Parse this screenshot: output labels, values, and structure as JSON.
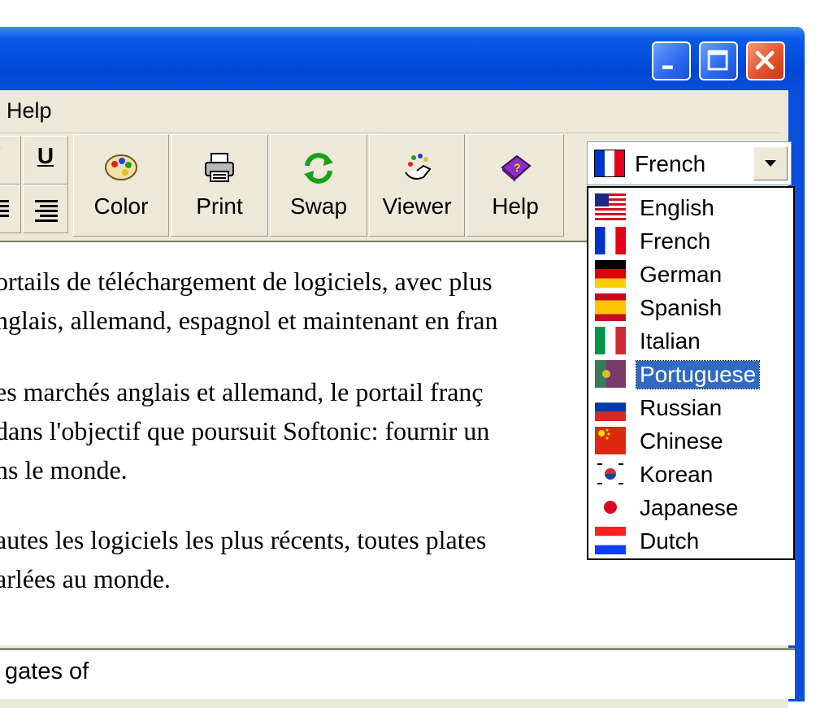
{
  "window": {
    "buttons": {
      "minimize_icon": "minimize-icon",
      "maximize_icon": "maximize-icon",
      "close_icon": "close-icon"
    }
  },
  "menu": {
    "help_label": "Help"
  },
  "toolbar": {
    "format_buttons": [
      "italic-icon",
      "underline-icon",
      "align-center-icon",
      "align-right-icon"
    ],
    "underline_label": "U",
    "color_label": "Color",
    "print_label": "Print",
    "swap_label": "Swap",
    "viewer_label": "Viewer",
    "help_label": "Help"
  },
  "language_select": {
    "selected": "French",
    "options": [
      {
        "label": "English"
      },
      {
        "label": "French"
      },
      {
        "label": "German"
      },
      {
        "label": "Spanish"
      },
      {
        "label": "Italian"
      },
      {
        "label": "Portuguese",
        "highlighted": true
      },
      {
        "label": "Russian"
      },
      {
        "label": "Chinese"
      },
      {
        "label": "Korean"
      },
      {
        "label": "Japanese"
      },
      {
        "label": "Dutch"
      }
    ]
  },
  "document": {
    "lines": [
      "ortails de téléchargement de logiciels, avec plus",
      "nglais, allemand, espagnol et maintenant en fran",
      "es marchés anglais et allemand, le portail franç",
      " dans l'objectif que poursuit Softonic: fournir un",
      "ns le monde.",
      "autes les logiciels les plus récents, toutes plates",
      "arlées au monde."
    ]
  },
  "lower_pane": {
    "text": " gates of"
  },
  "colors": {
    "titlebar": "#0a50d8",
    "face": "#ece9d8",
    "selection": "#316ac5"
  }
}
